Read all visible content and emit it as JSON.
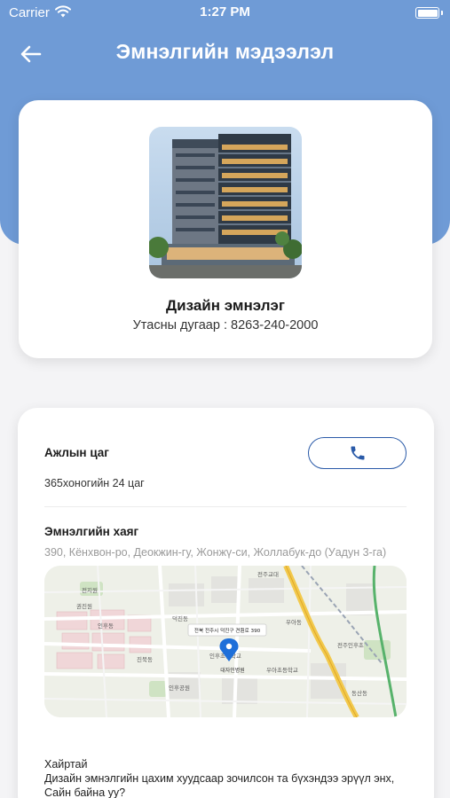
{
  "status_bar": {
    "carrier": "Carrier",
    "time": "1:27 PM"
  },
  "header": {
    "title": "Эмнэлгийн мэдээлэл"
  },
  "hospital": {
    "name": "Дизайн эмнэлэг",
    "phone_text": "Утасны дугаар : 8263-240-2000"
  },
  "details": {
    "work_hours_label": "Ажлын цаг",
    "work_hours_value": "365хоногийн 24 цаг",
    "address_label": "Эмнэлгийн хаяг",
    "address_value": "390, Кёнхвон-ро, Деокжин-гу, Жонжү-си, Жоллабук-до (Уадун 3-га)"
  },
  "map": {
    "callout": "전북 전주시 덕진구 견훤로 390",
    "pin_label": "대자인병원",
    "place_labels": [
      "전지원",
      "권진원",
      "인후동",
      "전주교대",
      "진북동",
      "덕진동",
      "우아동",
      "인후초등학교",
      "우아초등학교",
      "인후공원",
      "전주인후초",
      "동산동"
    ]
  },
  "greeting": {
    "line1": "Хайртай",
    "line2": "Дизайн эмнэлгийн цахим хуудсаар зочилсон та бүхэндээ эрүүл энх,",
    "line3": "Сайн байна уу?"
  },
  "colors": {
    "header": "#6f9bd6",
    "accent": "#2a5aa8",
    "map_pin": "#1e6fd9"
  },
  "icons": {
    "back": "arrow-left-icon",
    "call": "phone-icon",
    "wifi": "wifi-icon",
    "battery": "battery-icon",
    "pin": "map-pin-icon"
  }
}
